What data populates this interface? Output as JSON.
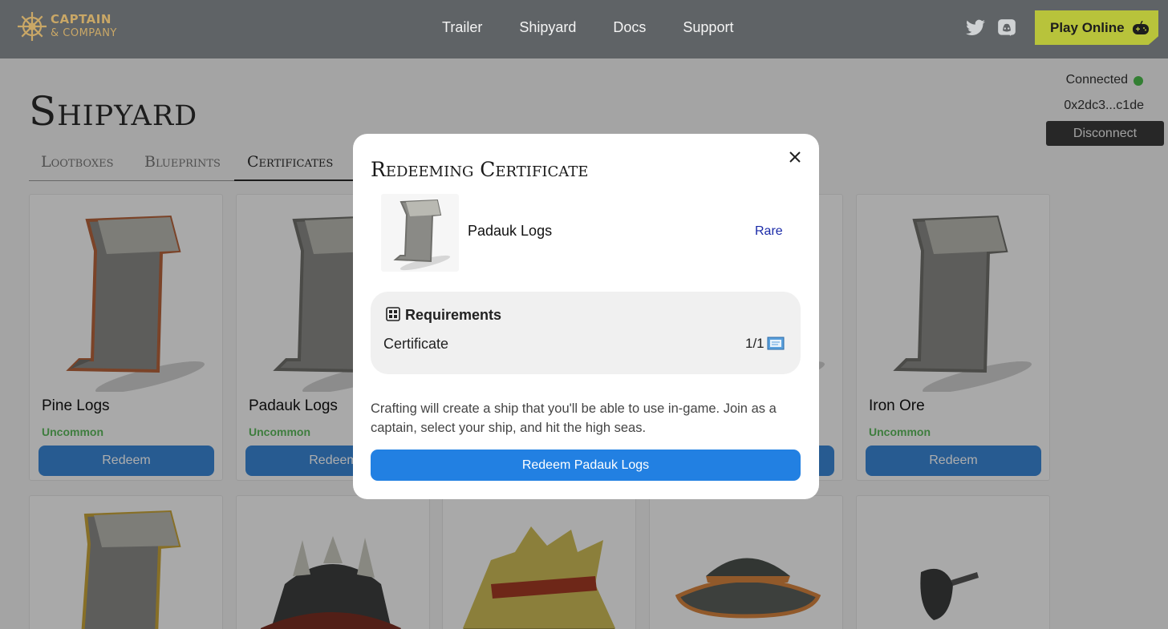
{
  "nav": {
    "logo_line1": "CAPTAIN",
    "logo_line2": "& COMPANY",
    "links": [
      "Trailer",
      "Shipyard",
      "Docs",
      "Support"
    ],
    "play_label": "Play Online",
    "social_icons": [
      "twitter-icon",
      "discord-icon"
    ]
  },
  "page": {
    "title": "Shipyard",
    "tabs": [
      "Lootboxes",
      "Blueprints",
      "Certificates"
    ],
    "active_tab": "Certificates"
  },
  "wallet": {
    "status": "Connected",
    "status_color": "#4cbb4c",
    "address": "0x2dc3...c1de",
    "disconnect_label": "Disconnect"
  },
  "cards": [
    {
      "name": "Pine Logs",
      "rarity": "Uncommon",
      "button": "Redeem",
      "edge_color": "#b5643c"
    },
    {
      "name": "Padauk Logs",
      "rarity": "Uncommon",
      "button": "Redeem",
      "edge_color": "#8a8a86"
    },
    {
      "name": "",
      "rarity": "",
      "button": "",
      "edge_color": "#8a8a86"
    },
    {
      "name": "",
      "rarity": "",
      "button": "",
      "edge_color": "#8a8a86"
    },
    {
      "name": "Iron Ore",
      "rarity": "Uncommon",
      "button": "Redeem",
      "edge_color": "#8a8a86"
    }
  ],
  "second_row_icons": [
    "scroll-icon",
    "helmet-icon",
    "hat-icon",
    "bucket-hat-icon",
    "eyepatch-icon"
  ],
  "modal": {
    "title": "Redeeming Certificate",
    "item_name": "Padauk Logs",
    "item_rarity": "Rare",
    "requirements_title": "Requirements",
    "requirement_item": "Certificate",
    "requirement_count": "1/1",
    "description": "Crafting will create a ship that you'll be able to use in-game. Join as a captain, select your ship, and hit the high seas.",
    "button_label": "Redeem Padauk Logs"
  },
  "colors": {
    "nav_bg": "#5f6366",
    "play_btn": "#b8c33b",
    "card_btn": "#3a86d6",
    "modal_btn": "#2280e2",
    "uncommon": "#5cb85c",
    "rare": "#1a2aa8"
  }
}
